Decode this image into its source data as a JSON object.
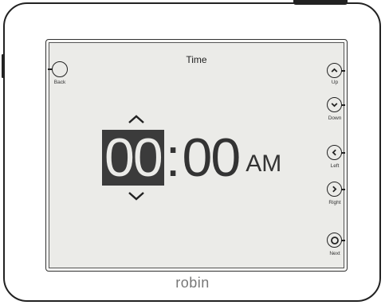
{
  "brand": "robin",
  "screen": {
    "title": "Time"
  },
  "buttons": {
    "back": "Back",
    "up": "Up",
    "down": "Down",
    "left": "Left",
    "right": "Right",
    "next": "Next"
  },
  "time": {
    "hour": "00",
    "separator": ":",
    "minute": "00",
    "ampm": "AM"
  },
  "icons": {
    "back": "circle-icon",
    "up": "chevron-up-icon",
    "down": "chevron-down-icon",
    "left": "chevron-left-icon",
    "right": "chevron-right-icon",
    "next": "ring-icon",
    "hour_up": "chevron-up-icon",
    "hour_down": "chevron-down-icon"
  },
  "colors": {
    "selected_bg": "#3b3b3b",
    "screen_bg": "#ebebe8"
  }
}
